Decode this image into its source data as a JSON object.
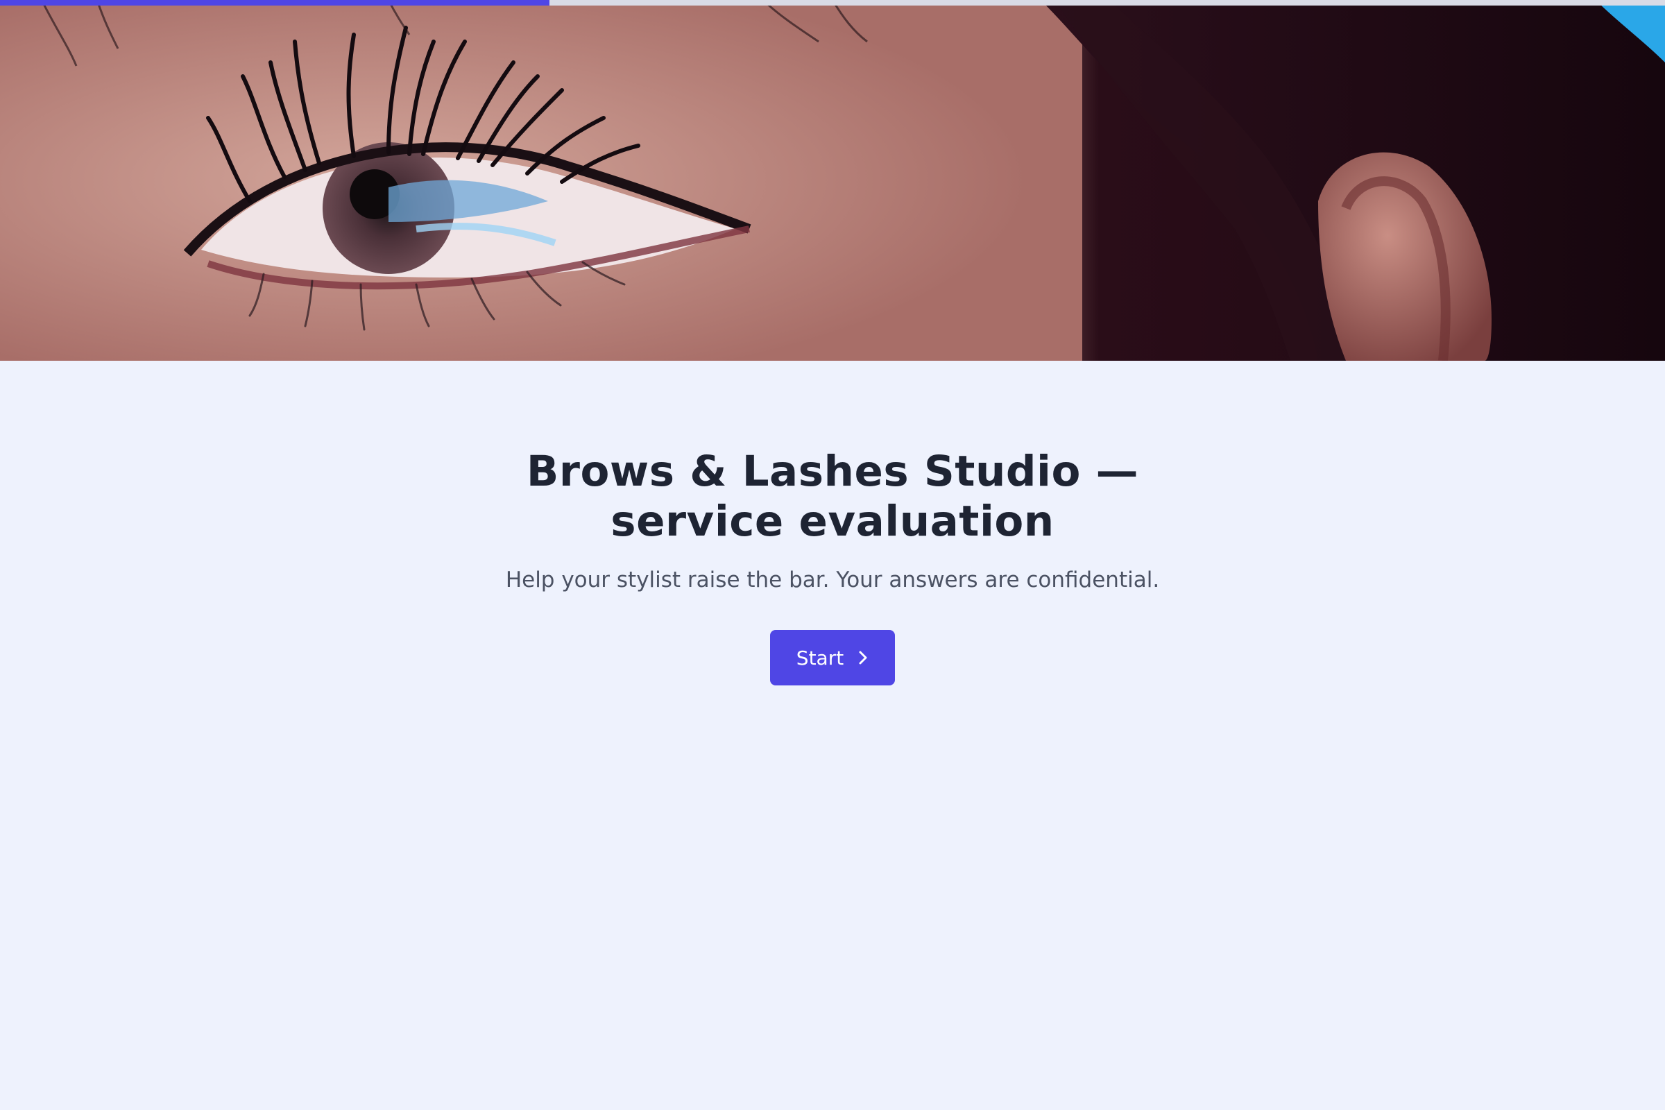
{
  "progress": {
    "fraction": 0.33,
    "color": "#4f46e5"
  },
  "hero": {
    "image": "close-up photo of eye with long lashes, cheek and ear"
  },
  "intro": {
    "title": "Brows & Lashes Studio — service evaluation",
    "subtitle": "Help your stylist raise the bar. Your answers are confidential.",
    "start_label": "Start",
    "start_icon": "chevron-right-icon"
  },
  "colors": {
    "accent": "#4f46e5",
    "background": "#eef2fd",
    "title": "#1e2433",
    "subtitle": "#4b5263"
  }
}
